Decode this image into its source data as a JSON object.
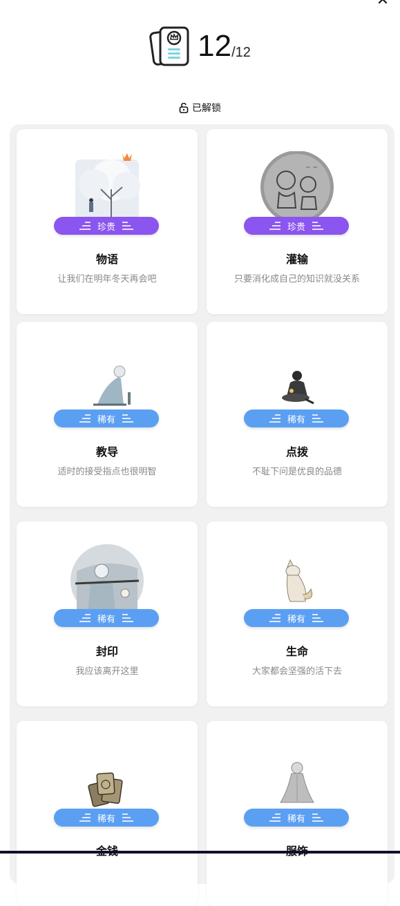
{
  "header": {
    "count": "12",
    "total": "/12",
    "unlocked_label": "已解锁"
  },
  "colors": {
    "precious": "#8b55ef",
    "rare": "#5b9ff3"
  },
  "cards": [
    {
      "name": "物语",
      "desc": "让我们在明年冬天再会吧",
      "rarity": "珍贵",
      "icon": "snow-tree-illustration"
    },
    {
      "name": "灌输",
      "desc": "只要消化成自己的知识就没关系",
      "rarity": "珍贵",
      "icon": "sketch-drawing-illustration"
    },
    {
      "name": "教导",
      "desc": "适时的接受指点也很明智",
      "rarity": "稀有",
      "icon": "kneeling-figure-illustration"
    },
    {
      "name": "点拨",
      "desc": "不耻下问是优良的品德",
      "rarity": "稀有",
      "icon": "sitting-figure-illustration"
    },
    {
      "name": "封印",
      "desc": "我应该离开这里",
      "rarity": "稀有",
      "icon": "sealed-figure-illustration"
    },
    {
      "name": "生命",
      "desc": "大家都会坚强的活下去",
      "rarity": "稀有",
      "icon": "fox-illustration"
    },
    {
      "name": "金钱",
      "desc": "",
      "rarity": "稀有",
      "icon": "coins-illustration"
    },
    {
      "name": "服饰",
      "desc": "",
      "rarity": "稀有",
      "icon": "cloak-illustration"
    }
  ]
}
